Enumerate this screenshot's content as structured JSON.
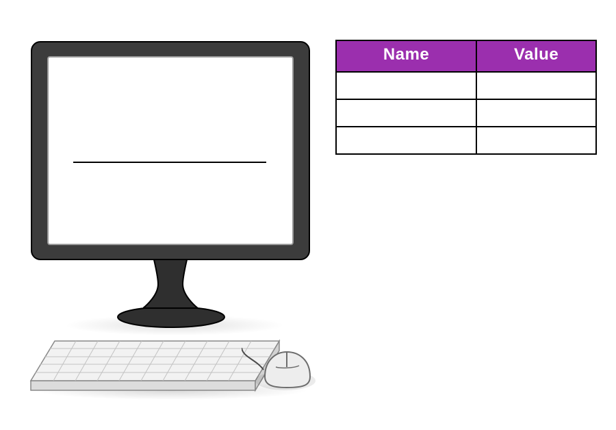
{
  "colors": {
    "table_header_bg": "#9b2fae",
    "table_header_text": "#ffffff",
    "bezel": "#3c3c3c",
    "keyboard_top": "#f2f2f2",
    "keyboard_side": "#dcdcdc",
    "keyboard_line": "#c2c2c2",
    "mouse_fill": "#eeeeee"
  },
  "monitor": {
    "screen_content_line": true
  },
  "table": {
    "headers": {
      "name": "Name",
      "value": "Value"
    },
    "rows": [
      {
        "name": "",
        "value": ""
      },
      {
        "name": "",
        "value": ""
      },
      {
        "name": "",
        "value": ""
      }
    ]
  }
}
